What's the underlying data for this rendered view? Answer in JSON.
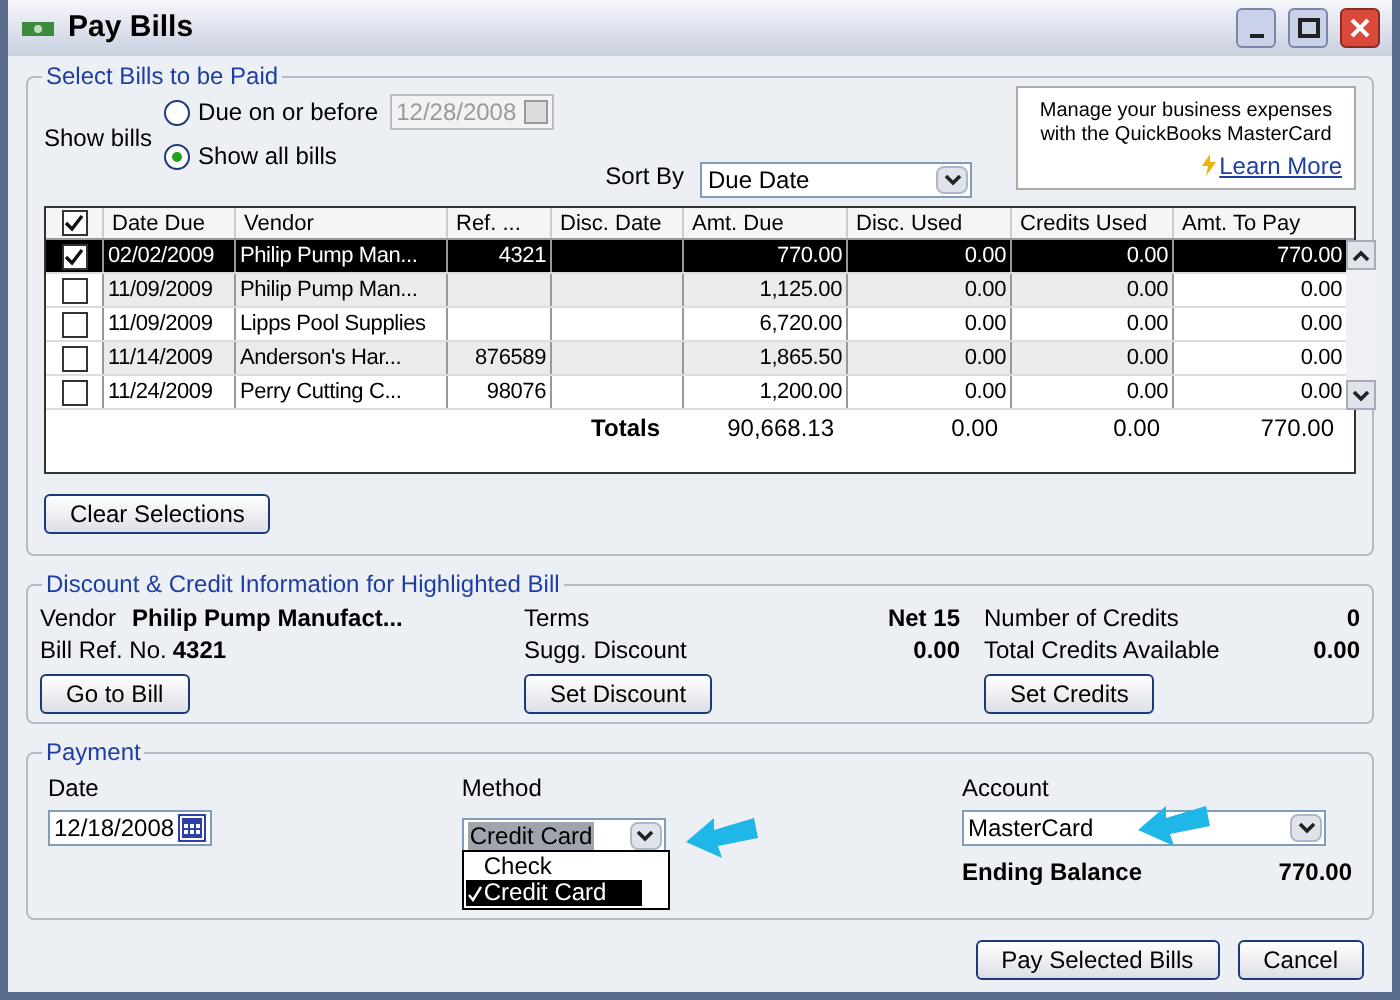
{
  "window": {
    "title": "Pay Bills"
  },
  "select_bills": {
    "title": "Select Bills to be Paid",
    "show_bills_label": "Show bills",
    "options": [
      {
        "label": "Due on or before",
        "selected": false
      },
      {
        "label": "Show all bills",
        "selected": true
      }
    ],
    "due_date": {
      "value": "12/28/2008",
      "disabled": true
    },
    "sort_by": {
      "label": "Sort By",
      "value": "Due Date"
    },
    "promo": {
      "text": "Manage your business expenses with the QuickBooks MasterCard",
      "link": "Learn More"
    }
  },
  "table": {
    "header_checked": true,
    "columns": [
      "Date Due",
      "Vendor",
      "Ref. ...",
      "Disc. Date",
      "Amt. Due",
      "Disc. Used",
      "Credits Used",
      "Amt. To Pay"
    ],
    "rows": [
      {
        "checked": true,
        "selected": true,
        "cells": [
          "02/02/2009",
          "Philip Pump Man...",
          "4321",
          "",
          "770.00",
          "0.00",
          "0.00",
          "770.00"
        ]
      },
      {
        "checked": false,
        "selected": false,
        "cells": [
          "11/09/2009",
          "Philip Pump Man...",
          "",
          "",
          "1,125.00",
          "0.00",
          "0.00",
          "0.00"
        ]
      },
      {
        "checked": false,
        "selected": false,
        "cells": [
          "11/09/2009",
          "Lipps Pool Supplies",
          "",
          "",
          "6,720.00",
          "0.00",
          "0.00",
          "0.00"
        ]
      },
      {
        "checked": false,
        "selected": false,
        "cells": [
          "11/14/2009",
          "Anderson's Har...",
          "876589",
          "",
          "1,865.50",
          "0.00",
          "0.00",
          "0.00"
        ]
      },
      {
        "checked": false,
        "selected": false,
        "cells": [
          "11/24/2009",
          "Perry Cutting C...",
          "98076",
          "",
          "1,200.00",
          "0.00",
          "0.00",
          "0.00"
        ]
      }
    ],
    "totals": {
      "label": "Totals",
      "amt_due": "90,668.13",
      "disc_used": "0.00",
      "credits_used": "0.00",
      "amt_to_pay": "770.00"
    }
  },
  "clear_button": "Clear Selections",
  "discount": {
    "title": "Discount & Credit Information for Highlighted Bill",
    "vendor_label": "Vendor",
    "vendor": "Philip Pump Manufact...",
    "bill_ref_label": "Bill Ref. No.",
    "bill_ref": "4321",
    "terms_label": "Terms",
    "terms": "Net 15",
    "sugg_label": "Sugg. Discount",
    "sugg": "0.00",
    "num_credits_label": "Number of Credits",
    "num_credits": "0",
    "total_credits_label": "Total Credits Available",
    "total_credits": "0.00",
    "buttons": [
      "Go to Bill",
      "Set Discount",
      "Set Credits"
    ]
  },
  "payment": {
    "title": "Payment",
    "date_label": "Date",
    "date": "12/18/2008",
    "method_label": "Method",
    "method": "Credit Card",
    "method_options": [
      {
        "label": "Check",
        "selected": false
      },
      {
        "label": "Credit Card",
        "selected": true
      }
    ],
    "account_label": "Account",
    "account": "MasterCard",
    "ending_balance_label": "Ending Balance",
    "ending_balance": "770.00"
  },
  "buttons": [
    "Pay Selected Bills",
    "Cancel"
  ]
}
